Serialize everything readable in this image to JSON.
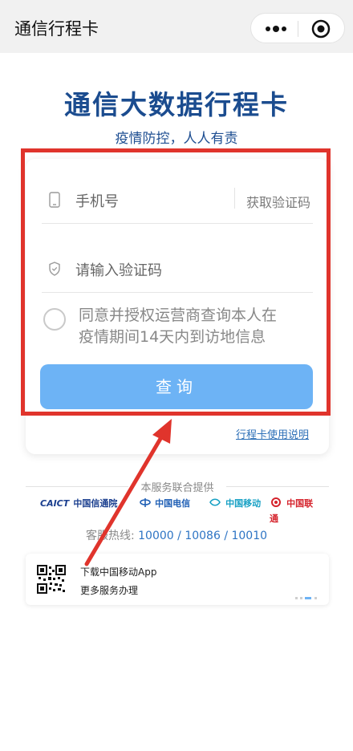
{
  "header": {
    "title": "通信行程卡",
    "menu_icon": "more-dots-icon",
    "close_icon": "target-circle-icon"
  },
  "page": {
    "heading": "通信大数据行程卡",
    "subheading": "疫情防控，人人有责"
  },
  "form": {
    "phone_placeholder": "手机号",
    "get_code_label": "获取验证码",
    "code_placeholder": "请输入验证码",
    "consent_line1": "同意并授权运营商查询本人在",
    "consent_line2": "疫情期间14天内到访地信息",
    "consent_checked": false,
    "submit_label": "查询",
    "help_link": "行程卡使用说明"
  },
  "providers": {
    "label": "本服务联合提供",
    "logos": [
      {
        "name": "CAICT",
        "text": "中国信通院"
      },
      {
        "name": "China Telecom",
        "text": "中国电信"
      },
      {
        "name": "China Mobile",
        "text": "中国移动"
      },
      {
        "name": "China Unicom",
        "text": "中国联通"
      }
    ]
  },
  "hotline": {
    "label": "客服热线:",
    "numbers": [
      "10000",
      "10086",
      "10010"
    ],
    "separator": "/"
  },
  "banner": {
    "line1": "下载中国移动App",
    "line2": "更多服务办理"
  },
  "colors": {
    "brand_blue": "#1b4c8f",
    "button_blue": "#6db3f5",
    "link_blue": "#2c6fb7",
    "annotation_red": "#e0342c",
    "topbar_bg": "#f1f1f1"
  }
}
